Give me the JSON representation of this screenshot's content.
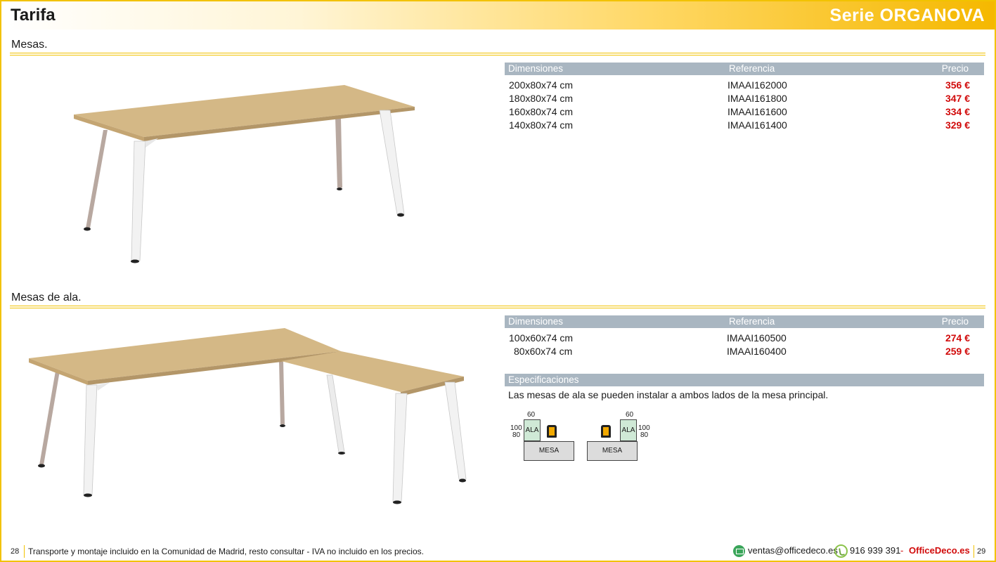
{
  "header": {
    "title": "Tarifa",
    "series": "Serie ORGANOVA"
  },
  "section1": {
    "title": "Mesas.",
    "columns": {
      "dim": "Dimensiones",
      "ref": "Referencia",
      "price": "Precio"
    },
    "rows": [
      {
        "dim": "200x80x74 cm",
        "ref": "IMAAI162000",
        "price": "356 €"
      },
      {
        "dim": "180x80x74 cm",
        "ref": "IMAAI161800",
        "price": "347 €"
      },
      {
        "dim": "160x80x74 cm",
        "ref": "IMAAI161600",
        "price": "334 €"
      },
      {
        "dim": "140x80x74 cm",
        "ref": "IMAAI161400",
        "price": "329 €"
      }
    ]
  },
  "section2": {
    "title": "Mesas de ala.",
    "columns": {
      "dim": "Dimensiones",
      "ref": "Referencia",
      "price": "Precio"
    },
    "rows": [
      {
        "dim": "100x60x74 cm",
        "ref": "IMAAI160500",
        "price": "274 €"
      },
      {
        "dim": "80x60x74 cm",
        "ref": "IMAAI160400",
        "price": "259 €"
      }
    ],
    "spec_title": "Especificaciones",
    "spec_text": "Las mesas de ala se pueden instalar a ambos lados de la mesa principal.",
    "diagram": {
      "width": "60",
      "depth_a": "100",
      "depth_b": "80",
      "ala": "ALA",
      "mesa": "MESA"
    }
  },
  "footer": {
    "page_left": "28",
    "page_right": "29",
    "note": "Transporte y montaje incluido en la Comunidad de Madrid, resto consultar - IVA no incluido en los precios.",
    "email": "ventas@officedeco.es",
    "phone": "916 939 391",
    "separator": "-",
    "brand": "OfficeDeco.es"
  },
  "colors": {
    "accent": "#f2c200",
    "table_header": "#a9b6c1",
    "price": "#d10a0a",
    "brand": "#d10a0a",
    "wood": "#d4b886",
    "legs": "#f2f2f2"
  }
}
